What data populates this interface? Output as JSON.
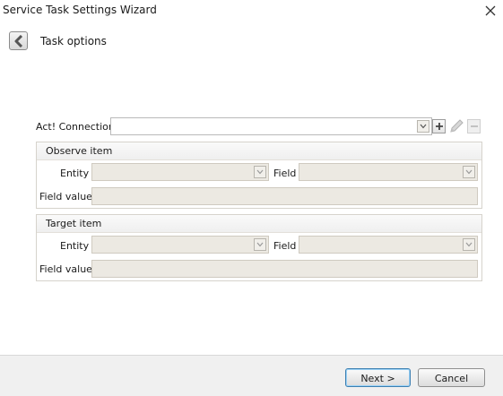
{
  "window": {
    "title": "Service Task Settings Wizard"
  },
  "page": {
    "title": "Task options"
  },
  "connection": {
    "label": "Act! Connection",
    "value": ""
  },
  "observe_item": {
    "title": "Observe item",
    "entity_label": "Entity",
    "entity_value": "",
    "field_label": "Field",
    "field_value": "",
    "field_value_label": "Field value",
    "field_value_value": ""
  },
  "target_item": {
    "title": "Target item",
    "entity_label": "Entity",
    "entity_value": "",
    "field_label": "Field",
    "field_value": "",
    "field_value_label": "Field value",
    "field_value_value": ""
  },
  "footer": {
    "next_label": "Next >",
    "cancel_label": "Cancel"
  },
  "icons": {
    "close": "close-icon",
    "back": "chevron-left-icon",
    "dropdown": "chevron-down-icon",
    "add": "plus-icon",
    "edit": "pencil-icon",
    "remove": "minus-icon"
  },
  "colors": {
    "primary_button_border": "#3c7fb1",
    "disabled_field": "#ece9e2"
  }
}
